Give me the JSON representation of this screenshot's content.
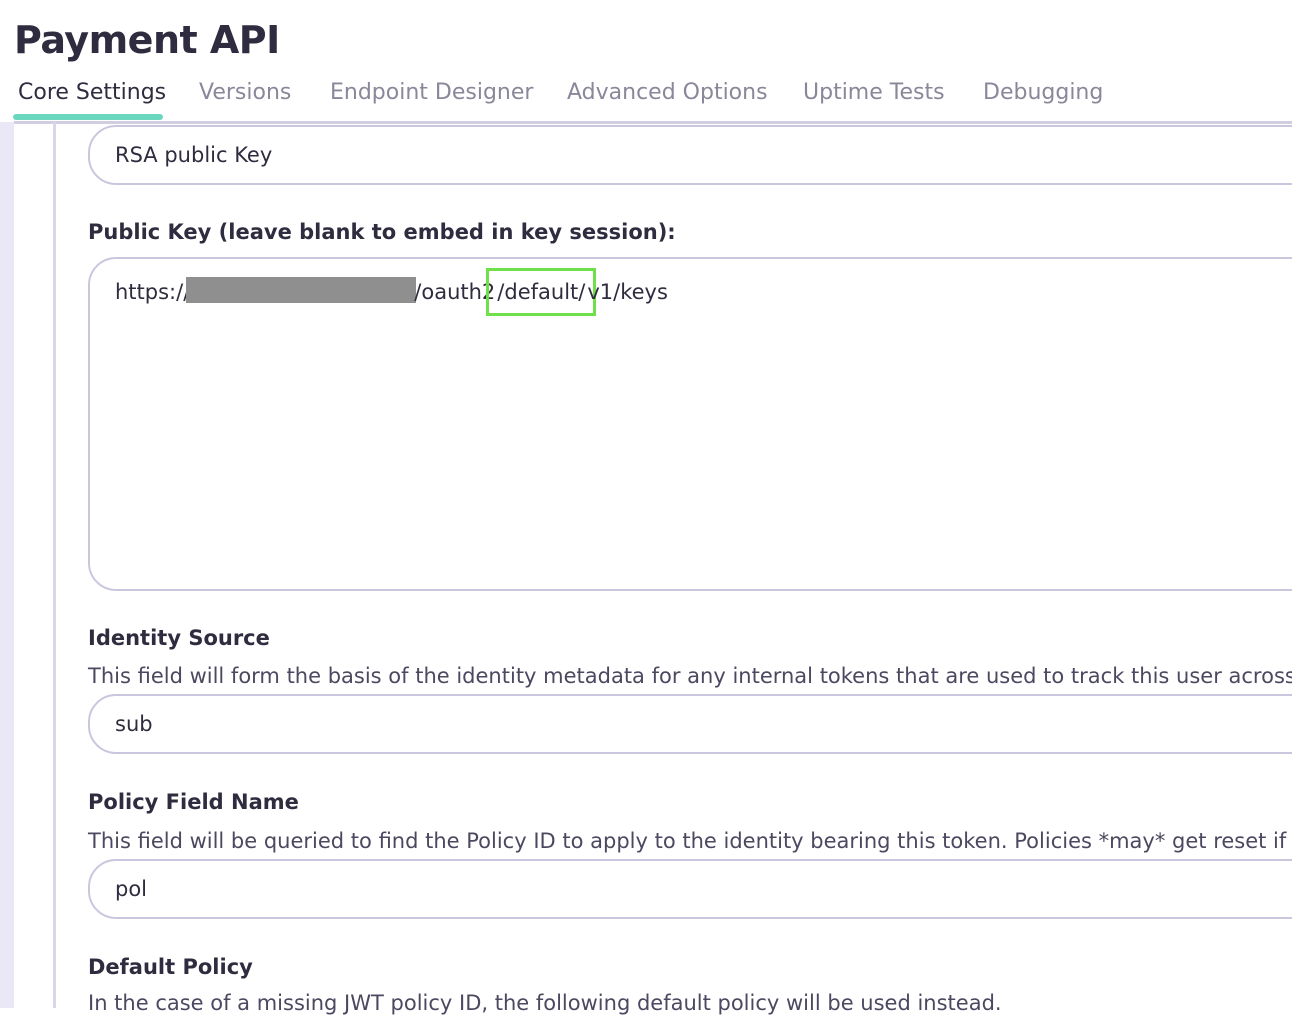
{
  "page": {
    "title": "Payment API"
  },
  "tabs": [
    {
      "label": "Core Settings",
      "active": true
    },
    {
      "label": "Versions",
      "active": false
    },
    {
      "label": "Endpoint Designer",
      "active": false
    },
    {
      "label": "Advanced Options",
      "active": false
    },
    {
      "label": "Uptime Tests",
      "active": false
    },
    {
      "label": "Debugging",
      "active": false
    }
  ],
  "signing_method": {
    "value": "RSA public Key"
  },
  "public_key": {
    "label": "Public Key (leave blank to embed in key session):",
    "url_prefix": "https://",
    "url_middle": "/oauth2",
    "url_highlight": "/default/",
    "url_suffix": "v1/keys"
  },
  "identity_source": {
    "label": "Identity Source",
    "help": "This field will form the basis of the identity metadata for any internal tokens that are used to track this user across A",
    "value": "sub"
  },
  "policy_field_name": {
    "label": "Policy Field Name",
    "help": "This field will be queried to find the Policy ID to apply to the identity bearing this token. Policies *may* get reset if th",
    "value": "pol"
  },
  "default_policy": {
    "label": "Default Policy",
    "help": "In the case of a missing JWT policy ID, the following default policy will be used instead."
  },
  "colors": {
    "accent": "#6cd7bf",
    "highlight_box": "#6fe04a",
    "border": "#c9c7dd",
    "redaction": "#8f8f8f"
  }
}
